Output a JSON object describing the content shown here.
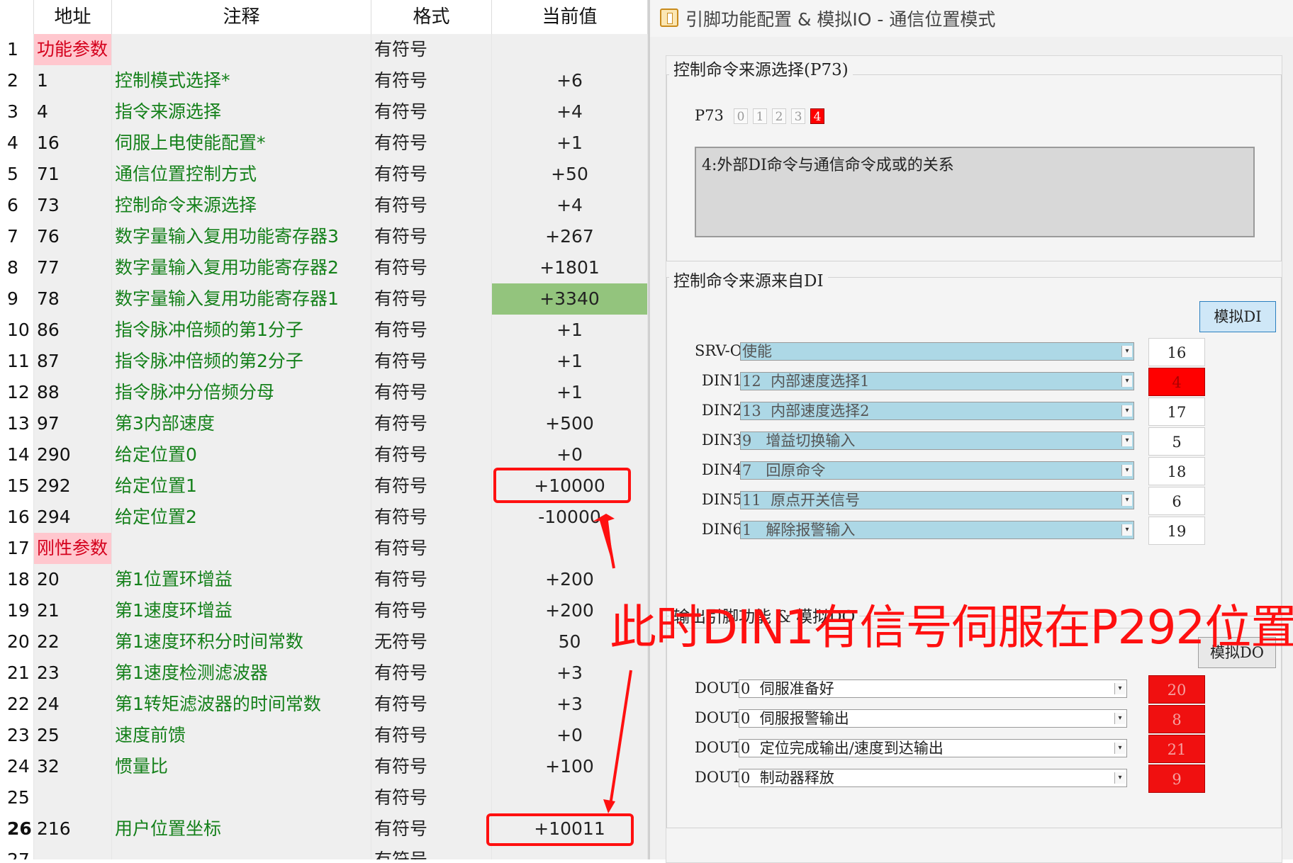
{
  "table": {
    "headers": [
      "地址",
      "注释",
      "格式",
      "当前值"
    ],
    "rows": [
      {
        "num": "1",
        "addr": "功能参数",
        "note": "",
        "fmt": "有符号",
        "val": "",
        "section": true
      },
      {
        "num": "2",
        "addr": "1",
        "note": "控制模式选择*",
        "fmt": "有符号",
        "val": "+6"
      },
      {
        "num": "3",
        "addr": "4",
        "note": "指令来源选择",
        "fmt": "有符号",
        "val": "+4"
      },
      {
        "num": "4",
        "addr": "16",
        "note": "伺服上电使能配置*",
        "fmt": "有符号",
        "val": "+1"
      },
      {
        "num": "5",
        "addr": "71",
        "note": "通信位置控制方式",
        "fmt": "有符号",
        "val": "+50"
      },
      {
        "num": "6",
        "addr": "73",
        "note": "控制命令来源选择",
        "fmt": "有符号",
        "val": "+4"
      },
      {
        "num": "7",
        "addr": "76",
        "note": "数字量输入复用功能寄存器3",
        "fmt": "有符号",
        "val": "+267"
      },
      {
        "num": "8",
        "addr": "77",
        "note": "数字量输入复用功能寄存器2",
        "fmt": "有符号",
        "val": "+1801"
      },
      {
        "num": "9",
        "addr": "78",
        "note": "数字量输入复用功能寄存器1",
        "fmt": "有符号",
        "val": "+3340",
        "highlight": true
      },
      {
        "num": "10",
        "addr": "86",
        "note": "指令脉冲倍频的第1分子",
        "fmt": "有符号",
        "val": "+1"
      },
      {
        "num": "11",
        "addr": "87",
        "note": "指令脉冲倍频的第2分子",
        "fmt": "有符号",
        "val": "+1"
      },
      {
        "num": "12",
        "addr": "88",
        "note": "指令脉冲分倍频分母",
        "fmt": "有符号",
        "val": "+1"
      },
      {
        "num": "13",
        "addr": "97",
        "note": "第3内部速度",
        "fmt": "有符号",
        "val": "+500"
      },
      {
        "num": "14",
        "addr": "290",
        "note": "给定位置0",
        "fmt": "有符号",
        "val": "+0"
      },
      {
        "num": "15",
        "addr": "292",
        "note": "给定位置1",
        "fmt": "有符号",
        "val": "+10000"
      },
      {
        "num": "16",
        "addr": "294",
        "note": "给定位置2",
        "fmt": "有符号",
        "val": "-10000"
      },
      {
        "num": "17",
        "addr": "刚性参数",
        "note": "",
        "fmt": "有符号",
        "val": "",
        "section": true
      },
      {
        "num": "18",
        "addr": "20",
        "note": "第1位置环增益",
        "fmt": "有符号",
        "val": "+200"
      },
      {
        "num": "19",
        "addr": "21",
        "note": "第1速度环增益",
        "fmt": "有符号",
        "val": "+200"
      },
      {
        "num": "20",
        "addr": "22",
        "note": "第1速度环积分时间常数",
        "fmt": "无符号",
        "val": "50"
      },
      {
        "num": "21",
        "addr": "23",
        "note": "第1速度检测滤波器",
        "fmt": "有符号",
        "val": "+3"
      },
      {
        "num": "22",
        "addr": "24",
        "note": "第1转矩滤波器的时间常数",
        "fmt": "有符号",
        "val": "+3"
      },
      {
        "num": "23",
        "addr": "25",
        "note": "速度前馈",
        "fmt": "有符号",
        "val": "+0"
      },
      {
        "num": "24",
        "addr": "32",
        "note": "惯量比",
        "fmt": "有符号",
        "val": "+100"
      },
      {
        "num": "25",
        "addr": "",
        "note": "",
        "fmt": "有符号",
        "val": ""
      },
      {
        "num": "26",
        "addr": "216",
        "note": "用户位置坐标",
        "fmt": "有符号",
        "val": "+10011",
        "bold": true
      },
      {
        "num": "27",
        "addr": "",
        "note": "",
        "fmt": "有符号",
        "val": ""
      }
    ]
  },
  "dialog": {
    "title": "引脚功能配置 & 模拟IO - 通信位置模式",
    "source_group": {
      "label": "控制命令来源选择(P73)",
      "param": "P73",
      "options": [
        "0",
        "1",
        "2",
        "3",
        "4"
      ],
      "selected": "4",
      "description": "4:外部DI命令与通信命令成或的关系"
    },
    "di_group": {
      "label": "控制命令来源来自DI",
      "button": "模拟DI",
      "rows": [
        {
          "name": "SRV-ON",
          "func": "使能",
          "value": "16",
          "state": "normal"
        },
        {
          "name": "DIN1",
          "func": "12  内部速度选择1",
          "value": "4",
          "state": "active"
        },
        {
          "name": "DIN2",
          "func": "13  内部速度选择2",
          "value": "17",
          "state": "normal"
        },
        {
          "name": "DIN3",
          "func": "9   增益切换输入",
          "value": "5",
          "state": "normal"
        },
        {
          "name": "DIN4",
          "func": "7   回原命令",
          "value": "18",
          "state": "normal"
        },
        {
          "name": "DIN5",
          "func": "11  原点开关信号",
          "value": "6",
          "state": "normal"
        },
        {
          "name": "DIN6",
          "func": "1   解除报警输入",
          "value": "19",
          "state": "normal"
        }
      ]
    },
    "do_group": {
      "label": "输出引脚功能 & 模拟DO",
      "button": "模拟DO",
      "rows": [
        {
          "name": "DOUT1",
          "func": "0  伺服准备好",
          "value": "20"
        },
        {
          "name": "DOUT2",
          "func": "0  伺服报警输出",
          "value": "8"
        },
        {
          "name": "DOUT3",
          "func": "0  定位完成输出/速度到达输出",
          "value": "21"
        },
        {
          "name": "DOUT4",
          "func": "0  制动器释放",
          "value": "9"
        }
      ]
    }
  },
  "annotation": {
    "text": "此时DIN1有信号伺服在P292位置",
    "color": "#ff1010"
  }
}
